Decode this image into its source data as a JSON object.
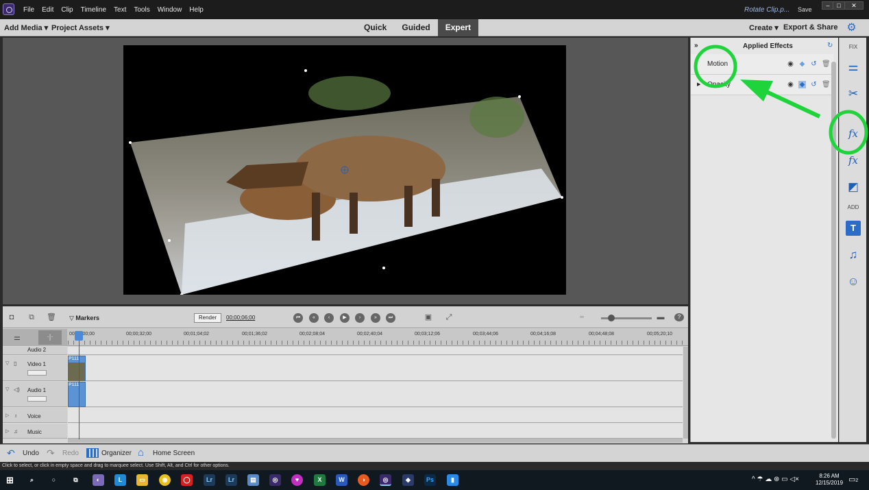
{
  "window": {
    "menus": [
      "File",
      "Edit",
      "Clip",
      "Timeline",
      "Text",
      "Tools",
      "Window",
      "Help"
    ],
    "doc_title": "Rotate Clip.p...",
    "save_label": "Save",
    "minimize": "–",
    "maximize": "□",
    "close": "✕"
  },
  "modebar": {
    "add_media": "Add Media ▾",
    "project_assets": "Project Assets ▾",
    "tabs": [
      "Quick",
      "Guided",
      "Expert"
    ],
    "active_tab": "Expert",
    "create": "Create ▾",
    "export_share": "Export & Share"
  },
  "effects_panel": {
    "collapse": "»",
    "title": "Applied Effects",
    "effects": [
      {
        "label": "Motion",
        "expanded": false
      },
      {
        "label": "Opacity",
        "expanded": false
      }
    ]
  },
  "sidebar": {
    "fix_label": "FIX",
    "add_label": "ADD",
    "buttons": [
      "adjustments-icon",
      "tools-icon",
      "applied-effects-icon",
      "effects-icon",
      "transitions-icon",
      "titles-icon",
      "music-icon",
      "graphics-icon"
    ]
  },
  "timeline": {
    "markers_label": "Markers",
    "render_label": "Render",
    "timecode": "00;00;06;00",
    "ruler_labels": [
      "00;00;00;00",
      "00;00;32;00",
      "00;01;04;02",
      "00;01;36;02",
      "00;02;08;04",
      "00;02;40;04",
      "00;03;12;06",
      "00;03;44;06",
      "00;04;16;08",
      "00;04;48;08",
      "00;05;20;10"
    ],
    "tracks": [
      {
        "name": "Audio 2",
        "type": "audio"
      },
      {
        "name": "Video 1",
        "type": "video",
        "clip": "P111"
      },
      {
        "name": "Audio 1",
        "type": "audio",
        "clip": "P111"
      },
      {
        "name": "Voice",
        "type": "voice"
      },
      {
        "name": "Music",
        "type": "music"
      }
    ]
  },
  "bottombar": {
    "undo": "Undo",
    "redo": "Redo",
    "organizer": "Organizer",
    "home_screen": "Home Screen"
  },
  "status": "Click to select, or click in empty space and drag to marquee select. Use Shift, Alt, and Ctrl for other options.",
  "taskbar": {
    "time": "8:26 AM",
    "date": "12/15/2019",
    "notifications": "2"
  },
  "colors": {
    "accent": "#1f5fb5",
    "annotation": "#1fd43a",
    "playhead": "#e02020"
  }
}
